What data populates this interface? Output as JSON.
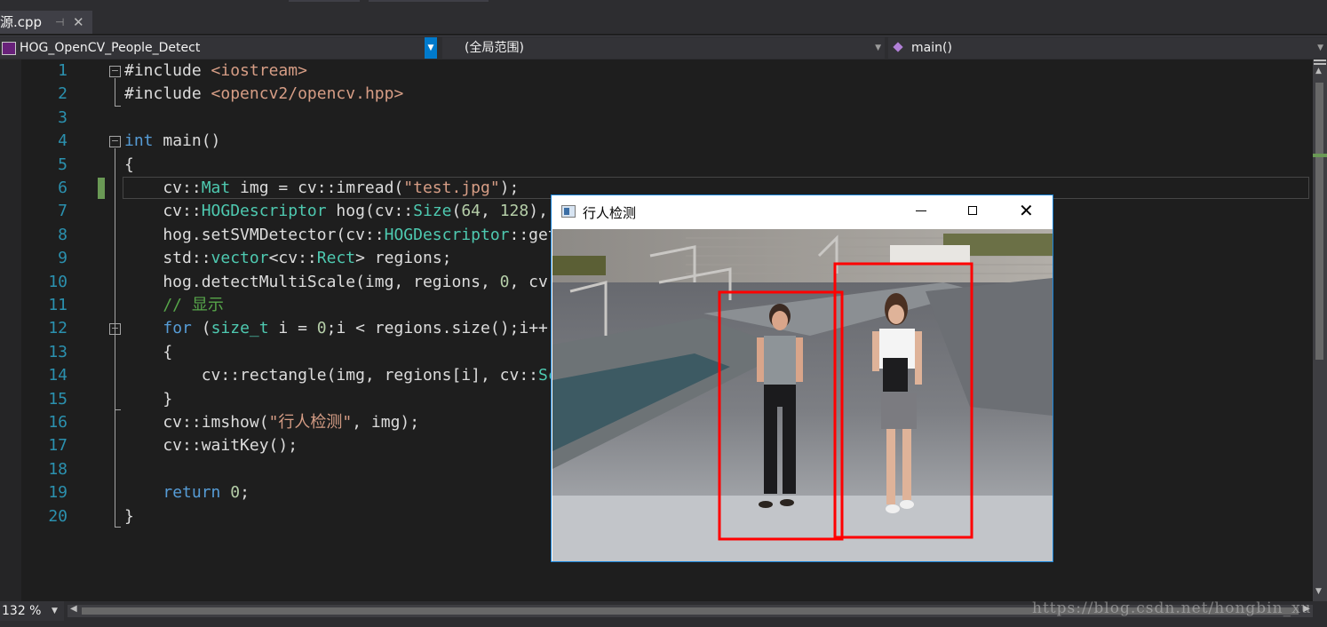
{
  "tab": {
    "filename": "源.cpp",
    "pin_icon": "pin-icon",
    "close_icon": "close-icon"
  },
  "navbar": {
    "project": "HOG_OpenCV_People_Detect",
    "scope": "(全局范围)",
    "function": "main()"
  },
  "code": {
    "line_numbers": [
      "1",
      "2",
      "3",
      "4",
      "5",
      "6",
      "7",
      "8",
      "9",
      "10",
      "11",
      "12",
      "13",
      "14",
      "15",
      "16",
      "17",
      "18",
      "19",
      "20"
    ],
    "lines": [
      [
        {
          "t": "#include ",
          "c": ""
        },
        {
          "t": "<iostream>",
          "c": "str"
        }
      ],
      [
        {
          "t": "#include ",
          "c": ""
        },
        {
          "t": "<opencv2/opencv.hpp>",
          "c": "str"
        }
      ],
      [],
      [
        {
          "t": "int",
          "c": "kw"
        },
        {
          "t": " main()",
          "c": ""
        }
      ],
      [
        {
          "t": "{",
          "c": ""
        }
      ],
      [
        {
          "t": "    cv::",
          "c": ""
        },
        {
          "t": "Mat",
          "c": "ty"
        },
        {
          "t": " img = cv::imread(",
          "c": ""
        },
        {
          "t": "\"test.jpg\"",
          "c": "str"
        },
        {
          "t": ");",
          "c": ""
        }
      ],
      [
        {
          "t": "    cv::",
          "c": ""
        },
        {
          "t": "HOGDescriptor",
          "c": "ty"
        },
        {
          "t": " hog(cv::",
          "c": ""
        },
        {
          "t": "Size",
          "c": "ty"
        },
        {
          "t": "(",
          "c": ""
        },
        {
          "t": "64",
          "c": "num"
        },
        {
          "t": ", ",
          "c": ""
        },
        {
          "t": "128",
          "c": "num"
        },
        {
          "t": "),",
          "c": ""
        }
      ],
      [
        {
          "t": "    hog.setSVMDetector(cv::",
          "c": ""
        },
        {
          "t": "HOGDescriptor",
          "c": "ty"
        },
        {
          "t": "::get",
          "c": ""
        }
      ],
      [
        {
          "t": "    std::",
          "c": ""
        },
        {
          "t": "vector",
          "c": "ty"
        },
        {
          "t": "<cv::",
          "c": ""
        },
        {
          "t": "Rect",
          "c": "ty"
        },
        {
          "t": "> regions;",
          "c": ""
        }
      ],
      [
        {
          "t": "    hog.detectMultiScale(img, regions, ",
          "c": ""
        },
        {
          "t": "0",
          "c": "num"
        },
        {
          "t": ", cv:",
          "c": ""
        }
      ],
      [
        {
          "t": "    // 显示",
          "c": "cm"
        }
      ],
      [
        {
          "t": "    ",
          "c": ""
        },
        {
          "t": "for",
          "c": "kw"
        },
        {
          "t": " (",
          "c": ""
        },
        {
          "t": "size_t",
          "c": "ty"
        },
        {
          "t": " i = ",
          "c": ""
        },
        {
          "t": "0",
          "c": "num"
        },
        {
          "t": ";i < regions.size();i++)",
          "c": ""
        }
      ],
      [
        {
          "t": "    {",
          "c": ""
        }
      ],
      [
        {
          "t": "        cv::rectangle(img, regions[i], cv::",
          "c": ""
        },
        {
          "t": "Sc",
          "c": "ty"
        }
      ],
      [
        {
          "t": "    }",
          "c": ""
        }
      ],
      [
        {
          "t": "    cv::imshow(",
          "c": ""
        },
        {
          "t": "\"行人检测\"",
          "c": "str"
        },
        {
          "t": ", img);",
          "c": ""
        }
      ],
      [
        {
          "t": "    cv::waitKey();",
          "c": ""
        }
      ],
      [],
      [
        {
          "t": "    ",
          "c": ""
        },
        {
          "t": "return",
          "c": "kw"
        },
        {
          "t": " ",
          "c": ""
        },
        {
          "t": "0",
          "c": "num"
        },
        {
          "t": ";",
          "c": ""
        }
      ],
      [
        {
          "t": "}",
          "c": ""
        }
      ]
    ]
  },
  "popup": {
    "title": "行人检测",
    "detections": 2,
    "box_color": "#ff0000"
  },
  "statusbar": {
    "zoom": "132 %"
  },
  "watermark": "https://blog.csdn.net/hongbin_xu",
  "colors": {
    "background": "#1e1e1e",
    "keyword": "#569cd6",
    "type": "#4ec9b0",
    "string": "#d69d85",
    "number": "#b5cea8",
    "comment": "#57a64a",
    "line_number": "#2b91af"
  }
}
